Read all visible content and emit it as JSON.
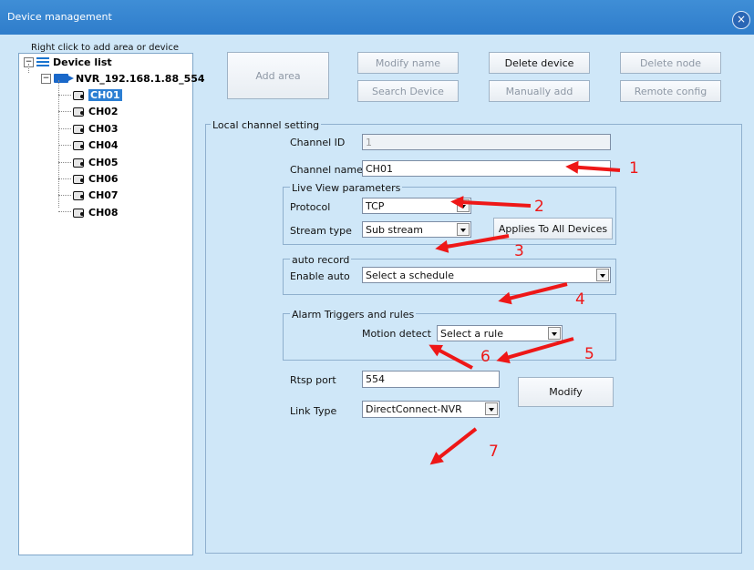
{
  "window": {
    "title": "Device management",
    "close_icon": "close-icon"
  },
  "tree": {
    "hint": "Right click to add area or device",
    "root_label": "Device list",
    "device_label": "NVR_192.168.1.88_554",
    "channels": [
      "CH01",
      "CH02",
      "CH03",
      "CH04",
      "CH05",
      "CH06",
      "CH07",
      "CH08"
    ],
    "selected": "CH01"
  },
  "toolbar": {
    "add_area": "Add area",
    "modify_name": "Modify name",
    "delete_device": "Delete device",
    "delete_node": "Delete node",
    "search_device": "Search Device",
    "manually_add": "Manually add",
    "remote_config": "Remote config"
  },
  "local_channel": {
    "group_title": "Local channel setting",
    "channel_id_label": "Channel ID",
    "channel_id_value": "1",
    "channel_name_label": "Channel name",
    "channel_name_value": "CH01",
    "live_view_title": "Live View parameters",
    "protocol_label": "Protocol",
    "protocol_value": "TCP",
    "stream_type_label": "Stream type",
    "stream_type_value": "Sub stream",
    "applies_button": "Applies To All Devices",
    "auto_record_title": "auto record",
    "enable_auto_label": "Enable auto",
    "schedule_value": "Select a schedule",
    "alarm_title": "Alarm Triggers and rules",
    "motion_label": "Motion detect",
    "rule_value": "Select a rule",
    "rtsp_label": "Rtsp port",
    "rtsp_value": "554",
    "link_type_label": "Link Type",
    "link_type_value": "DirectConnect-NVR",
    "modify_button": "Modify"
  },
  "annotations": [
    "1",
    "2",
    "3",
    "4",
    "5",
    "6",
    "7"
  ],
  "colors": {
    "accent": "#2f7dcb",
    "annotation": "#ee1717"
  }
}
